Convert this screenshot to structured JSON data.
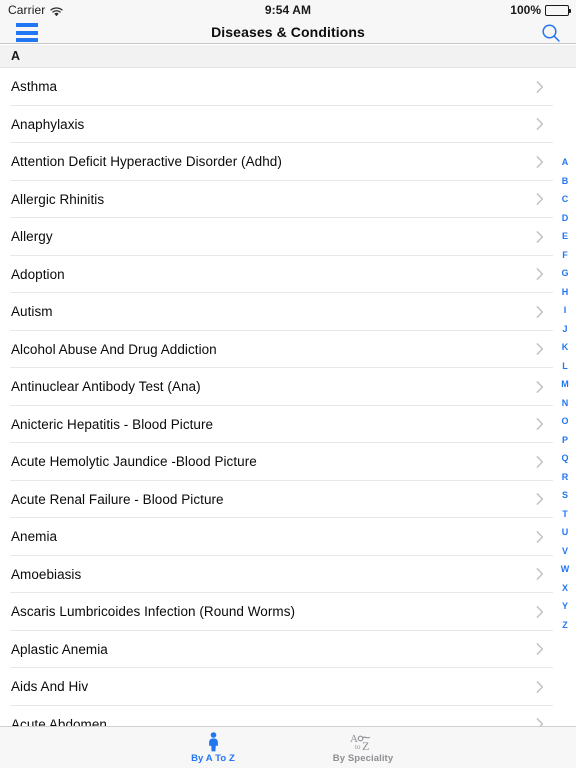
{
  "status_bar": {
    "carrier": "Carrier",
    "wifi_icon": "wifi-icon",
    "time": "9:54 AM",
    "battery_percent": "100%",
    "battery_icon": "battery-full-icon"
  },
  "nav_bar": {
    "menu_icon": "hamburger-menu-icon",
    "title": "Diseases & Conditions",
    "search_icon": "search-icon"
  },
  "section": {
    "header": "A"
  },
  "list": {
    "disclosure_icon": "chevron-right-icon",
    "items": [
      {
        "label": "Asthma"
      },
      {
        "label": "Anaphylaxis"
      },
      {
        "label": "Attention Deficit Hyperactive Disorder (Adhd)"
      },
      {
        "label": "Allergic Rhinitis"
      },
      {
        "label": "Allergy"
      },
      {
        "label": "Adoption"
      },
      {
        "label": "Autism"
      },
      {
        "label": "Alcohol Abuse And Drug Addiction"
      },
      {
        "label": "Antinuclear Antibody Test (Ana)"
      },
      {
        "label": "Anicteric Hepatitis - Blood Picture"
      },
      {
        "label": "Acute Hemolytic Jaundice -Blood Picture"
      },
      {
        "label": "Acute Renal Failure - Blood Picture"
      },
      {
        "label": "Anemia"
      },
      {
        "label": "Amoebiasis"
      },
      {
        "label": "Ascaris Lumbricoides Infection (Round Worms)"
      },
      {
        "label": "Aplastic Anemia"
      },
      {
        "label": "Aids And Hiv"
      },
      {
        "label": "Acute Abdomen"
      }
    ]
  },
  "index_bar": {
    "letters": [
      "A",
      "B",
      "C",
      "D",
      "E",
      "F",
      "G",
      "H",
      "I",
      "J",
      "K",
      "L",
      "M",
      "N",
      "O",
      "P",
      "Q",
      "R",
      "S",
      "T",
      "U",
      "V",
      "W",
      "X",
      "Y",
      "Z"
    ]
  },
  "tab_bar": {
    "tabs": [
      {
        "label": "By A To Z",
        "icon": "person-icon",
        "active": true
      },
      {
        "label": "By Speciality",
        "icon": "a-to-z-icon",
        "active": false
      }
    ]
  },
  "colors": {
    "accent": "#2176f3",
    "inactive": "#8e8e93",
    "bar_background": "#f7f7f7",
    "separator": "#e8e8e8"
  }
}
